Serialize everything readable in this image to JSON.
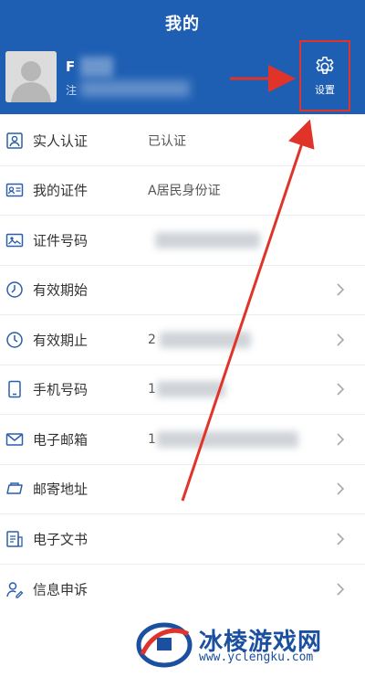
{
  "header": {
    "title": "我的",
    "name_initial": "F",
    "sub_initial": "注"
  },
  "settings": {
    "label": "设置"
  },
  "rows": [
    {
      "label": "实人认证",
      "value": "已认证",
      "icon": "id-card-icon"
    },
    {
      "label": "我的证件",
      "value": "A居民身份证",
      "icon": "document-card-icon"
    },
    {
      "label": "证件号码",
      "value": "",
      "icon": "photo-id-icon"
    },
    {
      "label": "有效期始",
      "value": "",
      "icon": "clock-icon"
    },
    {
      "label": "有效期止",
      "value": "2",
      "icon": "clock-icon"
    },
    {
      "label": "手机号码",
      "value": "1",
      "icon": "phone-icon"
    },
    {
      "label": "电子邮箱",
      "value": "1",
      "icon": "mail-icon"
    },
    {
      "label": "邮寄地址",
      "value": "",
      "icon": "parcel-icon"
    },
    {
      "label": "电子文书",
      "value": "",
      "icon": "e-document-icon"
    },
    {
      "label": "信息申诉",
      "value": "",
      "icon": "appeal-user-icon"
    }
  ],
  "watermark": {
    "text": "冰棱游戏网",
    "url": "www.yclengku.com"
  },
  "colors": {
    "header": "#1f5fb3",
    "highlight": "#e0342b",
    "icon": "#2a5ea8"
  }
}
